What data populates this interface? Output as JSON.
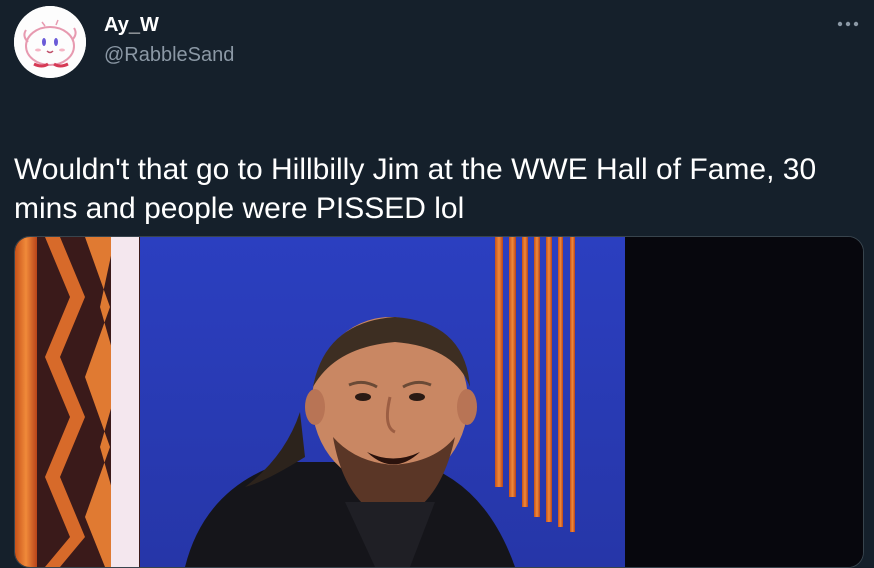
{
  "author": {
    "display_name": "Ay_W",
    "handle": "@RabbleSand",
    "avatar_icon": "kirby-drawing-avatar"
  },
  "more_menu": {
    "icon": "more-horizontal-icon"
  },
  "tweet": {
    "text": "Wouldn't that go to Hillbilly Jim at the WWE Hall of Fame, 30 mins and people were PISSED lol"
  },
  "media": {
    "type": "photo"
  },
  "colors": {
    "background": "#15202b",
    "secondary_text": "#8b98a5",
    "border": "#38444d"
  }
}
